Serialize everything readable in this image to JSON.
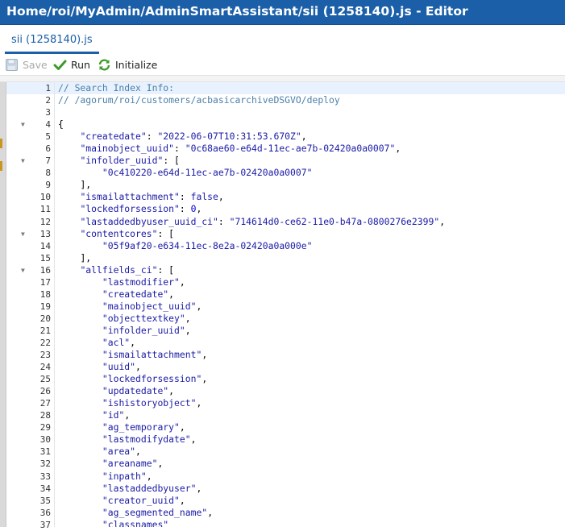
{
  "window": {
    "title": "Home/roi/MyAdmin/AdminSmartAssistant/sii (1258140).js - Editor"
  },
  "tab": {
    "label": "sii (1258140).js"
  },
  "toolbar": {
    "save": {
      "label": "Save",
      "icon": "save-icon",
      "disabled": true
    },
    "run": {
      "label": "Run",
      "icon": "checkmark-icon"
    },
    "initialize": {
      "label": "Initialize",
      "icon": "refresh-icon"
    }
  },
  "colors": {
    "title_bar": "#1b5fa8",
    "accent": "#1b5fa8",
    "comment": "#4b7fa9",
    "string": "#1a1aa6",
    "active_line": "#e8f2ff"
  },
  "editor": {
    "active_line": 1,
    "lines": [
      {
        "n": "1",
        "fold": false,
        "indent": 0,
        "tokens": [
          {
            "t": "cm",
            "v": "// Search Index Info:"
          }
        ]
      },
      {
        "n": "2",
        "fold": false,
        "indent": 0,
        "tokens": [
          {
            "t": "cm",
            "v": "// /agorum/roi/customers/acbasicarchiveDSGVO/deploy"
          }
        ]
      },
      {
        "n": "3",
        "fold": false,
        "indent": 0,
        "tokens": []
      },
      {
        "n": "4",
        "fold": true,
        "indent": 0,
        "tokens": [
          {
            "t": "pun",
            "v": "{"
          }
        ]
      },
      {
        "n": "5",
        "fold": false,
        "indent": 1,
        "tokens": [
          {
            "t": "str",
            "v": "\"createdate\""
          },
          {
            "t": "pun",
            "v": ": "
          },
          {
            "t": "str",
            "v": "\"2022-06-07T10:31:53.670Z\""
          },
          {
            "t": "pun",
            "v": ","
          }
        ]
      },
      {
        "n": "6",
        "fold": false,
        "indent": 1,
        "tokens": [
          {
            "t": "str",
            "v": "\"mainobject_uuid\""
          },
          {
            "t": "pun",
            "v": ": "
          },
          {
            "t": "str",
            "v": "\"0c68ae60-e64d-11ec-ae7b-02420a0a0007\""
          },
          {
            "t": "pun",
            "v": ","
          }
        ]
      },
      {
        "n": "7",
        "fold": true,
        "indent": 1,
        "tokens": [
          {
            "t": "str",
            "v": "\"infolder_uuid\""
          },
          {
            "t": "pun",
            "v": ": ["
          }
        ]
      },
      {
        "n": "8",
        "fold": false,
        "indent": 2,
        "tokens": [
          {
            "t": "str",
            "v": "\"0c410220-e64d-11ec-ae7b-02420a0a0007\""
          }
        ]
      },
      {
        "n": "9",
        "fold": false,
        "indent": 1,
        "tokens": [
          {
            "t": "pun",
            "v": "],"
          }
        ]
      },
      {
        "n": "10",
        "fold": false,
        "indent": 1,
        "tokens": [
          {
            "t": "str",
            "v": "\"ismailattachment\""
          },
          {
            "t": "pun",
            "v": ": "
          },
          {
            "t": "kw",
            "v": "false"
          },
          {
            "t": "pun",
            "v": ","
          }
        ]
      },
      {
        "n": "11",
        "fold": false,
        "indent": 1,
        "tokens": [
          {
            "t": "str",
            "v": "\"lockedforsession\""
          },
          {
            "t": "pun",
            "v": ": "
          },
          {
            "t": "num",
            "v": "0"
          },
          {
            "t": "pun",
            "v": ","
          }
        ]
      },
      {
        "n": "12",
        "fold": false,
        "indent": 1,
        "tokens": [
          {
            "t": "str",
            "v": "\"lastaddedbyuser_uuid_ci\""
          },
          {
            "t": "pun",
            "v": ": "
          },
          {
            "t": "str",
            "v": "\"714614d0-ce62-11e0-b47a-0800276e2399\""
          },
          {
            "t": "pun",
            "v": ","
          }
        ]
      },
      {
        "n": "13",
        "fold": true,
        "indent": 1,
        "tokens": [
          {
            "t": "str",
            "v": "\"contentcores\""
          },
          {
            "t": "pun",
            "v": ": ["
          }
        ]
      },
      {
        "n": "14",
        "fold": false,
        "indent": 2,
        "tokens": [
          {
            "t": "str",
            "v": "\"05f9af20-e634-11ec-8e2a-02420a0a000e\""
          }
        ]
      },
      {
        "n": "15",
        "fold": false,
        "indent": 1,
        "tokens": [
          {
            "t": "pun",
            "v": "],"
          }
        ]
      },
      {
        "n": "16",
        "fold": true,
        "indent": 1,
        "tokens": [
          {
            "t": "str",
            "v": "\"allfields_ci\""
          },
          {
            "t": "pun",
            "v": ": ["
          }
        ]
      },
      {
        "n": "17",
        "fold": false,
        "indent": 2,
        "tokens": [
          {
            "t": "str",
            "v": "\"lastmodifier\""
          },
          {
            "t": "pun",
            "v": ","
          }
        ]
      },
      {
        "n": "18",
        "fold": false,
        "indent": 2,
        "tokens": [
          {
            "t": "str",
            "v": "\"createdate\""
          },
          {
            "t": "pun",
            "v": ","
          }
        ]
      },
      {
        "n": "19",
        "fold": false,
        "indent": 2,
        "tokens": [
          {
            "t": "str",
            "v": "\"mainobject_uuid\""
          },
          {
            "t": "pun",
            "v": ","
          }
        ]
      },
      {
        "n": "20",
        "fold": false,
        "indent": 2,
        "tokens": [
          {
            "t": "str",
            "v": "\"objecttextkey\""
          },
          {
            "t": "pun",
            "v": ","
          }
        ]
      },
      {
        "n": "21",
        "fold": false,
        "indent": 2,
        "tokens": [
          {
            "t": "str",
            "v": "\"infolder_uuid\""
          },
          {
            "t": "pun",
            "v": ","
          }
        ]
      },
      {
        "n": "22",
        "fold": false,
        "indent": 2,
        "tokens": [
          {
            "t": "str",
            "v": "\"acl\""
          },
          {
            "t": "pun",
            "v": ","
          }
        ]
      },
      {
        "n": "23",
        "fold": false,
        "indent": 2,
        "tokens": [
          {
            "t": "str",
            "v": "\"ismailattachment\""
          },
          {
            "t": "pun",
            "v": ","
          }
        ]
      },
      {
        "n": "24",
        "fold": false,
        "indent": 2,
        "tokens": [
          {
            "t": "str",
            "v": "\"uuid\""
          },
          {
            "t": "pun",
            "v": ","
          }
        ]
      },
      {
        "n": "25",
        "fold": false,
        "indent": 2,
        "tokens": [
          {
            "t": "str",
            "v": "\"lockedforsession\""
          },
          {
            "t": "pun",
            "v": ","
          }
        ]
      },
      {
        "n": "26",
        "fold": false,
        "indent": 2,
        "tokens": [
          {
            "t": "str",
            "v": "\"updatedate\""
          },
          {
            "t": "pun",
            "v": ","
          }
        ]
      },
      {
        "n": "27",
        "fold": false,
        "indent": 2,
        "tokens": [
          {
            "t": "str",
            "v": "\"ishistoryobject\""
          },
          {
            "t": "pun",
            "v": ","
          }
        ]
      },
      {
        "n": "28",
        "fold": false,
        "indent": 2,
        "tokens": [
          {
            "t": "str",
            "v": "\"id\""
          },
          {
            "t": "pun",
            "v": ","
          }
        ]
      },
      {
        "n": "29",
        "fold": false,
        "indent": 2,
        "tokens": [
          {
            "t": "str",
            "v": "\"ag_temporary\""
          },
          {
            "t": "pun",
            "v": ","
          }
        ]
      },
      {
        "n": "30",
        "fold": false,
        "indent": 2,
        "tokens": [
          {
            "t": "str",
            "v": "\"lastmodifydate\""
          },
          {
            "t": "pun",
            "v": ","
          }
        ]
      },
      {
        "n": "31",
        "fold": false,
        "indent": 2,
        "tokens": [
          {
            "t": "str",
            "v": "\"area\""
          },
          {
            "t": "pun",
            "v": ","
          }
        ]
      },
      {
        "n": "32",
        "fold": false,
        "indent": 2,
        "tokens": [
          {
            "t": "str",
            "v": "\"areaname\""
          },
          {
            "t": "pun",
            "v": ","
          }
        ]
      },
      {
        "n": "33",
        "fold": false,
        "indent": 2,
        "tokens": [
          {
            "t": "str",
            "v": "\"inpath\""
          },
          {
            "t": "pun",
            "v": ","
          }
        ]
      },
      {
        "n": "34",
        "fold": false,
        "indent": 2,
        "tokens": [
          {
            "t": "str",
            "v": "\"lastaddedbyuser\""
          },
          {
            "t": "pun",
            "v": ","
          }
        ]
      },
      {
        "n": "35",
        "fold": false,
        "indent": 2,
        "tokens": [
          {
            "t": "str",
            "v": "\"creator_uuid\""
          },
          {
            "t": "pun",
            "v": ","
          }
        ]
      },
      {
        "n": "36",
        "fold": false,
        "indent": 2,
        "tokens": [
          {
            "t": "str",
            "v": "\"ag_segmented_name\""
          },
          {
            "t": "pun",
            "v": ","
          }
        ]
      },
      {
        "n": "37",
        "fold": false,
        "indent": 2,
        "tokens": [
          {
            "t": "str",
            "v": "\"classnames\""
          }
        ]
      }
    ]
  }
}
